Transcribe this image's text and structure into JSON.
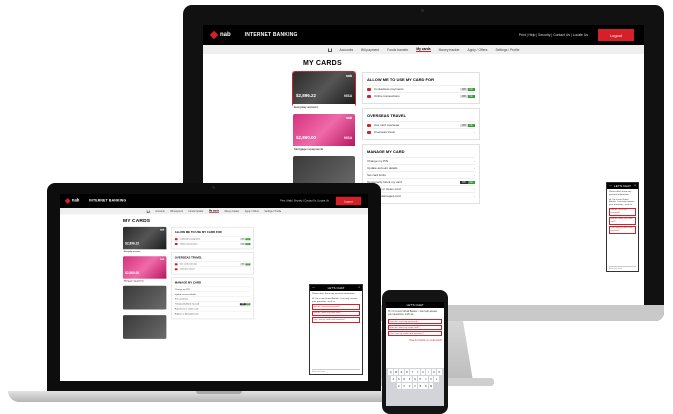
{
  "brand": {
    "logo": "nab",
    "title": "INTERNET BANKING"
  },
  "top_links": "Print | Help | Security | Contact Us | Locate Us",
  "logout_label": "Logout",
  "nav": [
    "Accounts",
    "Bill payment",
    "Funds transfer",
    "My cards",
    "Money tracker",
    "Apply / Offers",
    "Settings / Profile"
  ],
  "page_title": "MY CARDS",
  "cards": [
    {
      "amount": "$2,896.22",
      "label": "Everyday account",
      "style": "black",
      "brand": "VISA"
    },
    {
      "amount": "$2,860.00",
      "label": "Mortgage repayments",
      "style": "pink",
      "brand": "VISA"
    },
    {
      "amount": "",
      "label": "",
      "style": "dark",
      "brand": ""
    }
  ],
  "panels": {
    "allow": {
      "title": "ALLOW ME TO USE MY CARD FOR",
      "rows": [
        {
          "label": "Contactless payments",
          "off": "Off",
          "on": "On"
        },
        {
          "label": "Online transactions",
          "off": "Off",
          "on": "On"
        }
      ]
    },
    "overseas": {
      "title": "OVERSEAS TRAVEL",
      "rows": [
        {
          "label": "Use card overseas",
          "off": "Off",
          "on": "On"
        },
        {
          "label": "Overseas travel"
        }
      ]
    },
    "manage": {
      "title": "MANAGE MY CARD",
      "rows": [
        {
          "label": "Change my PIN"
        },
        {
          "label": "Update account details"
        },
        {
          "label": "Set card limits"
        },
        {
          "label": "Temporarily block my card",
          "off": "Off",
          "on": "On"
        },
        {
          "label": "Report lost or stolen card"
        },
        {
          "label": "Replace a damaged card"
        }
      ]
    }
  },
  "chat": {
    "title": "LET'S CHAT",
    "minimize": "—",
    "close": "×",
    "intro": "Please don't share any personal information.",
    "greeting": "Hi, I'm a new Virtual Banker. I can help answer your questions, such as:",
    "options": [
      "How do I reset my password?",
      "How do I block my credit card?",
      "Can I use my credit card overseas?"
    ],
    "phone_option": "How do I block my credit card?",
    "input_placeholder": "Enter text here"
  },
  "keyboard": {
    "rows": [
      [
        "Q",
        "W",
        "E",
        "R",
        "T",
        "Y",
        "U",
        "I",
        "O",
        "P"
      ],
      [
        "A",
        "S",
        "D",
        "F",
        "G",
        "H",
        "J",
        "K",
        "L"
      ],
      [
        "Z",
        "X",
        "C",
        "V",
        "B",
        "N",
        "M"
      ]
    ]
  }
}
